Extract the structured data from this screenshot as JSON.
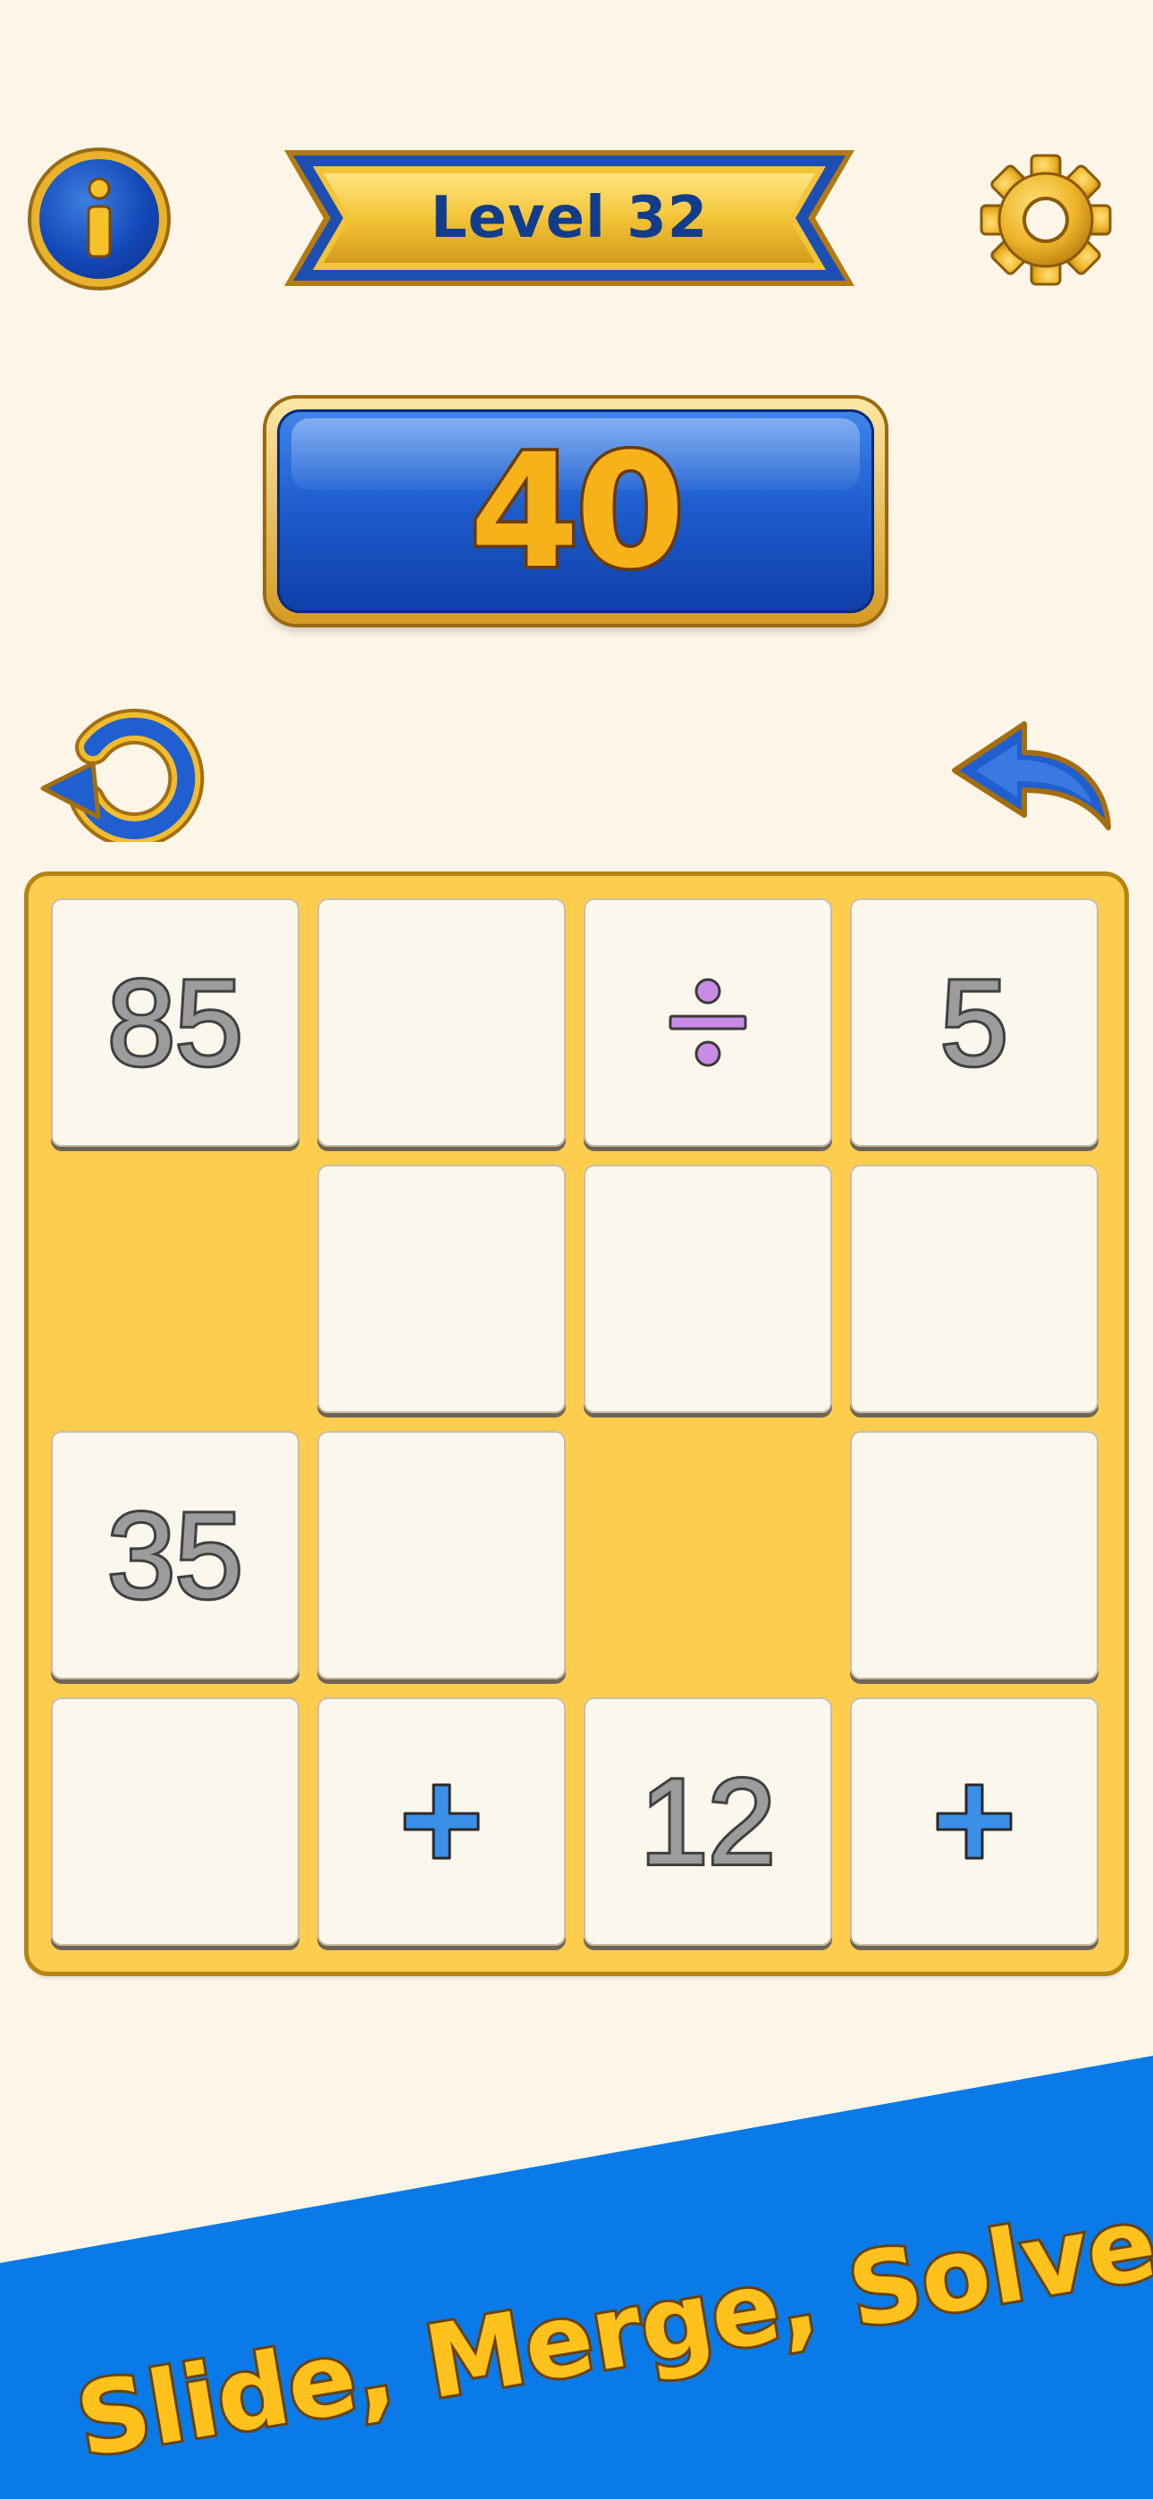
{
  "header": {
    "level_label": "Level 32"
  },
  "target": {
    "value": "40"
  },
  "board": {
    "rows": [
      [
        {
          "type": "number",
          "text": "85"
        },
        {
          "type": "tile",
          "text": ""
        },
        {
          "type": "operator",
          "op": "divide",
          "text": "÷"
        },
        {
          "type": "number",
          "text": "5"
        }
      ],
      [
        {
          "type": "empty",
          "text": ""
        },
        {
          "type": "tile",
          "text": ""
        },
        {
          "type": "tile",
          "text": ""
        },
        {
          "type": "tile",
          "text": ""
        }
      ],
      [
        {
          "type": "number",
          "text": "35"
        },
        {
          "type": "tile",
          "text": ""
        },
        {
          "type": "empty",
          "text": ""
        },
        {
          "type": "tile",
          "text": ""
        }
      ],
      [
        {
          "type": "tile",
          "text": ""
        },
        {
          "type": "operator",
          "op": "plus",
          "text": "+"
        },
        {
          "type": "number",
          "text": "12"
        },
        {
          "type": "operator",
          "op": "plus",
          "text": "+"
        }
      ]
    ]
  },
  "promo": {
    "tagline": "Slide, Merge, Solve!"
  },
  "icons": {
    "info": "info-icon",
    "settings": "gear-icon",
    "restart": "restart-icon",
    "undo": "undo-arrow-icon"
  },
  "colors": {
    "background": "#fdf6e8",
    "board": "#ffcd4d",
    "accent_blue": "#1f5fd0",
    "gold": "#f7b21a",
    "promo_band": "#0a7ae8",
    "divide_operator": "#c98be6",
    "plus_operator": "#3a8fe8"
  }
}
